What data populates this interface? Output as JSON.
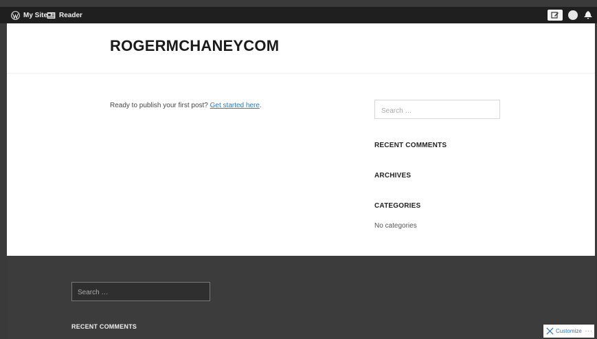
{
  "adminbar": {
    "my_site": "My Site",
    "reader": "Reader"
  },
  "header": {
    "site_title": "ROGERMCHANEYCOM"
  },
  "main": {
    "prompt_text": "Ready to publish your first post? ",
    "prompt_link": "Get started here",
    "prompt_tail": "."
  },
  "sidebar": {
    "search_placeholder": "Search …",
    "recent_comments": "RECENT COMMENTS",
    "archives": "ARCHIVES",
    "categories": "CATEGORIES",
    "no_categories": "No categories"
  },
  "footer": {
    "search_placeholder": "Search …",
    "recent_comments": "RECENT COMMENTS"
  },
  "customize": {
    "label": "Customize",
    "more": "···"
  },
  "colors": {
    "adminbar_bg": "#1f1f1f",
    "footer_bg": "#3c3c3c",
    "link": "#2b78c4"
  }
}
